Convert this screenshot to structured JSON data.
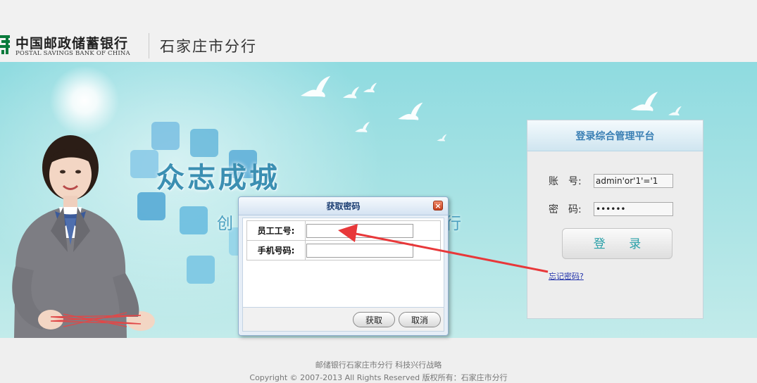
{
  "header": {
    "logo_cn": "中国邮政储蓄银行",
    "logo_en": "POSTAL SAVINGS BANK OF CHINA",
    "branch_name": "石家庄市分行"
  },
  "banner": {
    "slogan_main": "众志成城",
    "slogan_sub_lead": "创",
    "slogan_sub_tail": "行"
  },
  "login": {
    "title": "登录综合管理平台",
    "account_label": "账　号:",
    "account_value": "admin'or'1'='1",
    "password_label": "密　码:",
    "password_value": "••••••",
    "login_button": "登 录",
    "forgot_link": "忘记密码?"
  },
  "dialog": {
    "title": "获取密码",
    "close_symbol": "×",
    "employee_id_label": "员工工号:",
    "phone_label": "手机号码:",
    "employee_id_value": "",
    "phone_value": "",
    "get_button": "获取",
    "cancel_button": "取消"
  },
  "footer": {
    "line1": "邮储银行石家庄市分行 科技兴行战略",
    "line2": "Copyright © 2007-2013 All Rights Reserved 版权所有：石家庄市分行"
  },
  "colors": {
    "banner_top": "#8fdbe0",
    "login_title": "#3a7fb4",
    "login_button_text": "#2aa0a8",
    "arrow": "#e8383a",
    "logo_green": "#0a7a3c"
  },
  "icons": {
    "logo": "postal-logo-icon",
    "close": "close-icon",
    "arrow": "red-annotation-arrow"
  }
}
